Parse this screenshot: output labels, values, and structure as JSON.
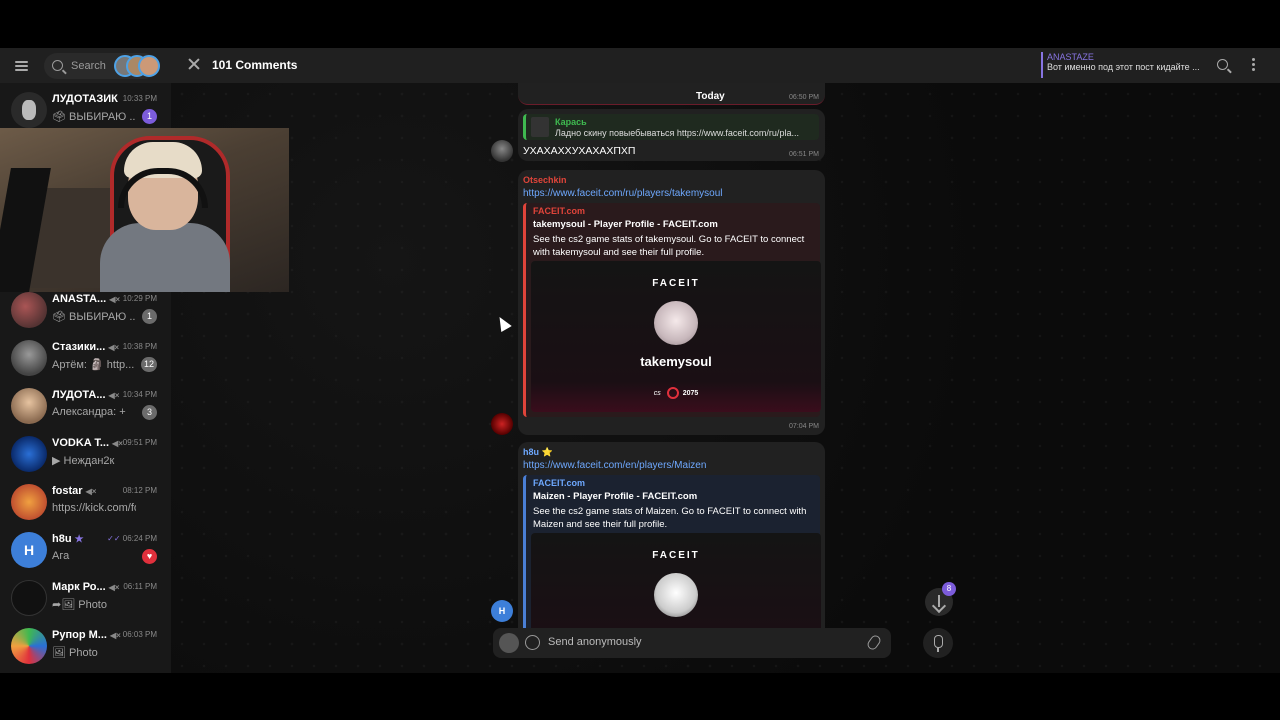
{
  "sidebar": {
    "search_placeholder": "Search",
    "chats": [
      {
        "name": "ЛУДОТАЗИК",
        "time": "10:33 PM",
        "preview": "🗳 ВЫБИРАЮ ...",
        "badge": "1",
        "badge_color": "purple"
      },
      {
        "name": "ANASTA...",
        "time": "10:29 PM",
        "preview": "🗳 ВЫБИРАЮ ...",
        "badge": "1",
        "badge_color": "gray"
      },
      {
        "name": "Стазики...",
        "time": "10:38 PM",
        "preview": "Артём: 🗿 http...",
        "badge": "12",
        "badge_color": "gray"
      },
      {
        "name": "ЛУДОТА...",
        "time": "10:34 PM",
        "preview": "Александра: +",
        "badge": "3",
        "badge_color": "gray"
      },
      {
        "name": "VODKA T...",
        "time": "09:51 PM",
        "preview": "▶ Неждан2к",
        "badge": "",
        "badge_color": "gray"
      },
      {
        "name": "fostar",
        "time": "08:12 PM",
        "preview": "https://kick.com/fo...",
        "badge": "",
        "badge_color": "gray"
      },
      {
        "name": "h8u",
        "time": "06:24 PM",
        "preview": "Ага",
        "badge": "♥",
        "badge_color": "red"
      },
      {
        "name": "Марк Ро...",
        "time": "06:11 PM",
        "preview": "➦🖼 Photo",
        "badge": "",
        "badge_color": "gray"
      },
      {
        "name": "Рупор М...",
        "time": "06:03 PM",
        "preview": "🖼 Photo",
        "badge": "",
        "badge_color": "gray"
      }
    ],
    "h8u_initial": "H"
  },
  "header": {
    "title": "101 Comments",
    "pinned_name": "ANASTAZE",
    "pinned_text": "Вот именно под этот пост кидайте ..."
  },
  "chat": {
    "top_time": "06:50 PM",
    "date_label": "Today",
    "msg1": {
      "reply_name": "Карась",
      "reply_text": "Ладно скину повыебываться https://www.faceit.com/ru/pla...",
      "text": "УХАХАХХУХАХАХПХП",
      "time": "06:51 PM"
    },
    "msg2": {
      "sender": "Otsechkin",
      "link": "https://www.faceit.com/ru/players/takemysoul",
      "site": "FACEIT.com",
      "title": "takemysoul - Player Profile - FACEIT.com",
      "desc": "See the cs2 game stats of takemysoul. Go to FACEIT to connect with takemysoul and see their full profile.",
      "card_logo": "FACEIT",
      "card_name": "takemysoul",
      "card_elo": "2075",
      "card_game": "cs",
      "time": "07:04 PM"
    },
    "msg3": {
      "sender": "h8u ⭐",
      "link": "https://www.faceit.com/en/players/Maizen",
      "site": "FACEIT.com",
      "title": "Maizen - Player Profile - FACEIT.com",
      "desc": "See the cs2 game stats of Maizen. Go to FACEIT to connect with Maizen and see their full profile.",
      "card_logo": "FACEIT",
      "avatar_initial": "H"
    },
    "scroll_badge": "8",
    "composer_placeholder": "Send anonymously"
  },
  "colors": {
    "accent": "#8774e1",
    "link": "#6ea8fe",
    "faceit": "#ff5500",
    "reply_green": "#3fb950"
  }
}
